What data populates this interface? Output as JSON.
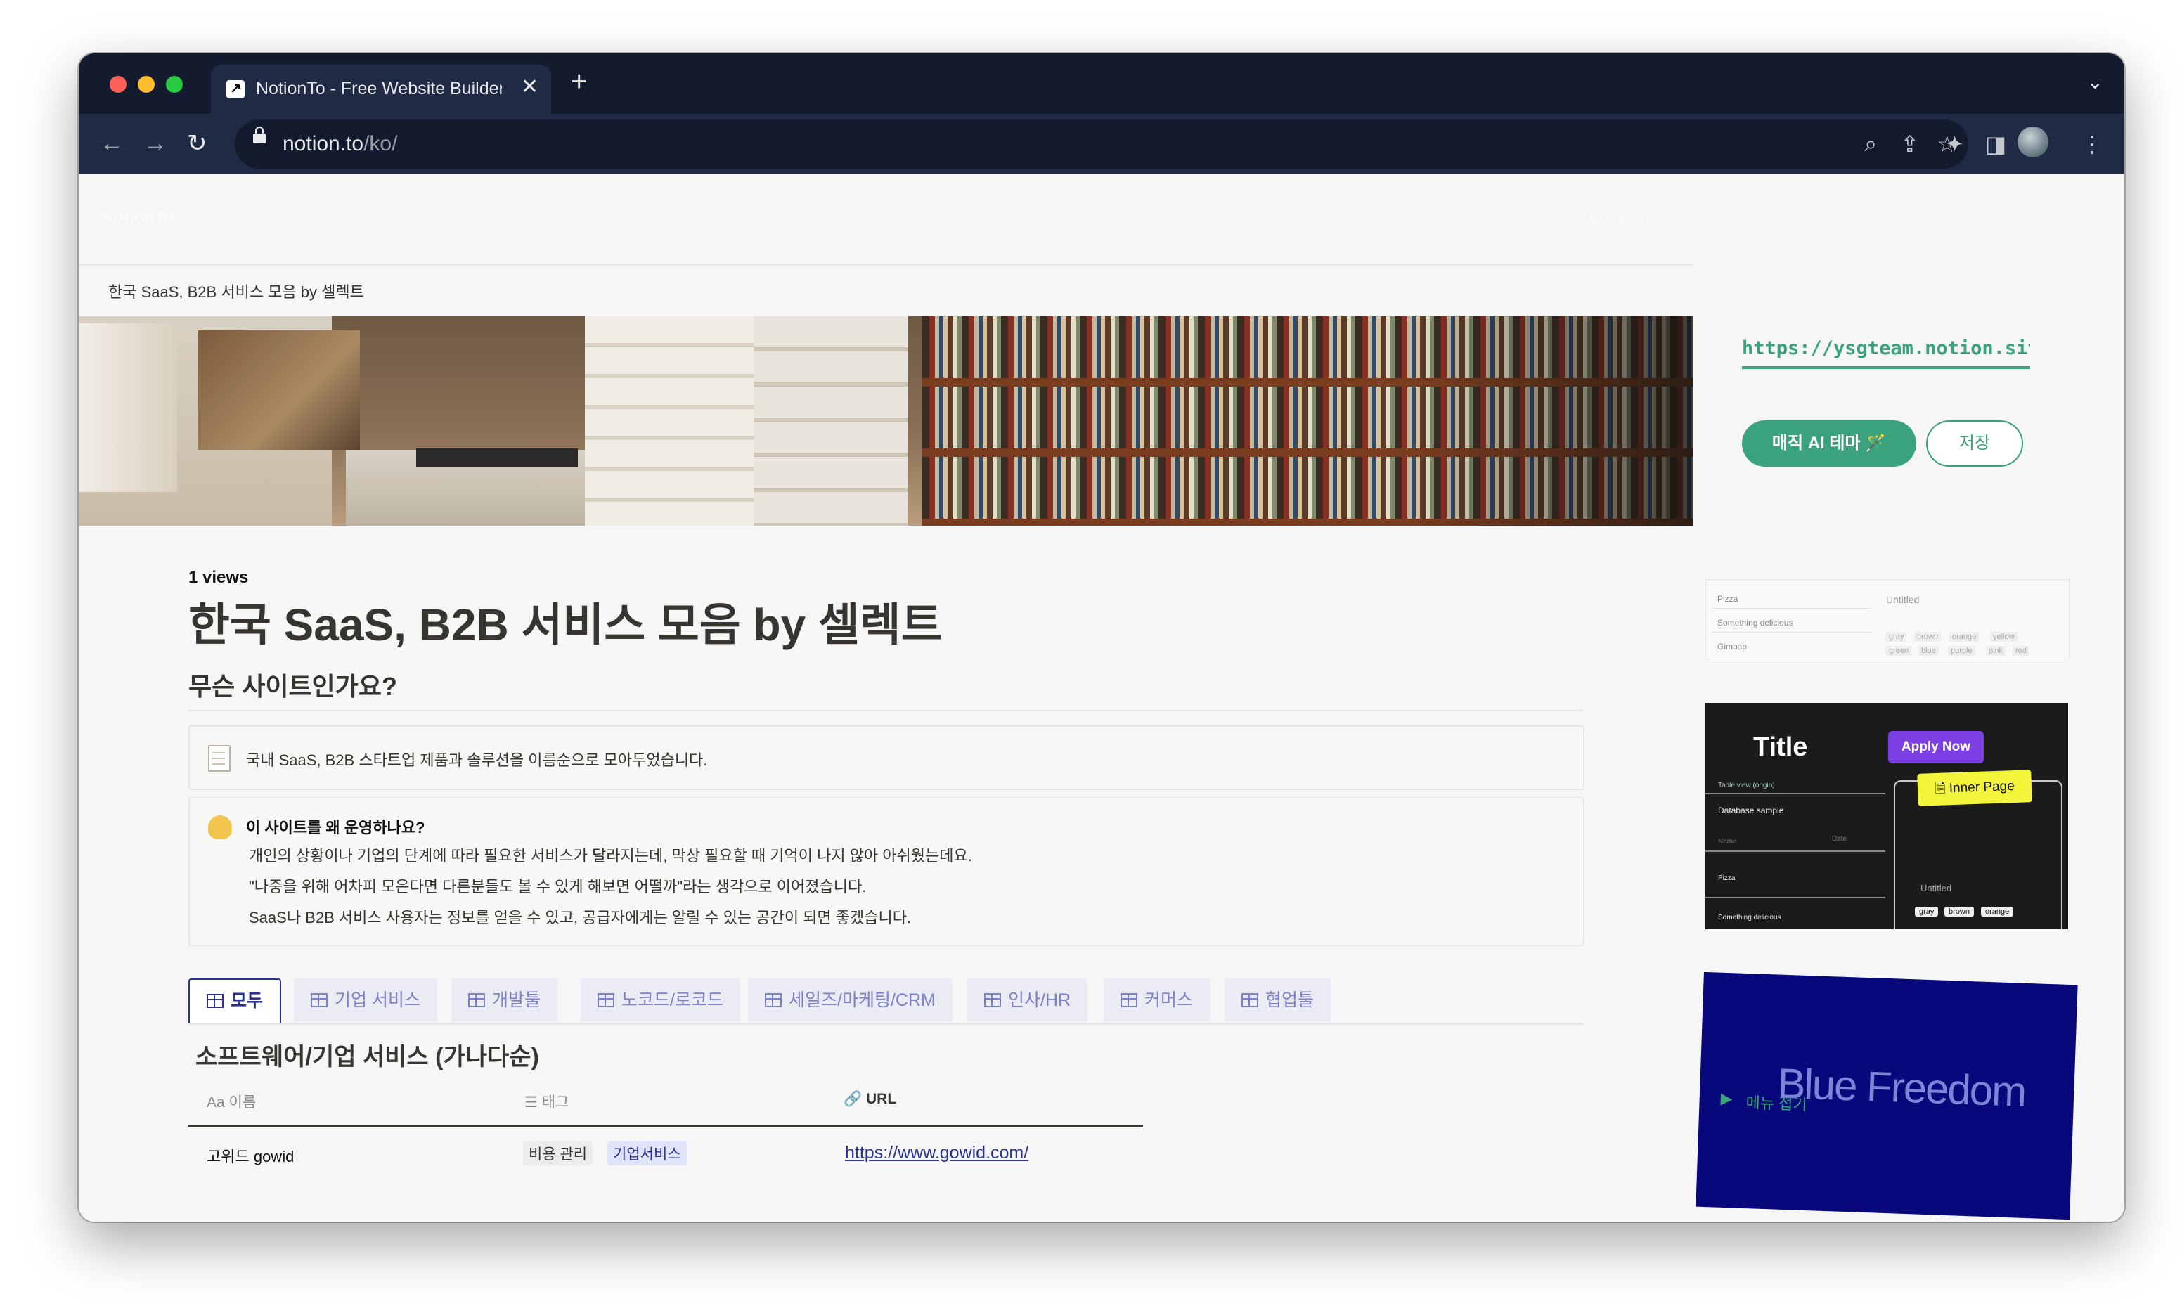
{
  "browser": {
    "tab_title": "NotionTo - Free Website Builder",
    "new_tab_symbol": "+",
    "close_symbol": "✕",
    "url_host": "notion.to",
    "url_path": "/ko/"
  },
  "site": {
    "logo": "NotionTo",
    "header_link": "노션보기",
    "breadcrumb": "한국 SaaS, B2B 서비스 모음 by 셀렉트"
  },
  "page": {
    "views": "1 views",
    "title": "한국 SaaS, B2B 서비스 모음 by 셀렉트",
    "section_heading": "무슨 사이트인가요?",
    "callout1_text": "국내 SaaS, B2B 스타트업 제품과 솔루션을 이름순으로 모아두었습니다.",
    "callout2": {
      "heading": "이 사이트를 왜 운영하나요?",
      "lines": [
        "개인의 상황이나 기업의 단계에 따라 필요한 서비스가 달라지는데, 막상 필요할 때 기억이 나지 않아 아쉬웠는데요.",
        "\"나중을 위해 어차피 모은다면 다른분들도 볼 수 있게 해보면 어떨까\"라는 생각으로 이어졌습니다.",
        "SaaS나 B2B 서비스 사용자는 정보를 얻을 수 있고, 공급자에게는 알릴 수 있는 공간이 되면 좋겠습니다."
      ]
    },
    "db_tabs": [
      "모두",
      "기업 서비스",
      "개발툴",
      "노코드/로코드",
      "세일즈/마케팅/CRM",
      "인사/HR",
      "커머스",
      "협업툴"
    ],
    "db_title": "소프트웨어/기업 서비스 (가나다순)",
    "columns": {
      "name": "이름",
      "name_prefix": "Aa",
      "tags": "태그",
      "url": "URL"
    },
    "rows": [
      {
        "name": "고위드 gowid",
        "tag1": "비용 관리",
        "tag2": "기업서비스",
        "url": "https://www.gowid.com/"
      }
    ]
  },
  "sidebar": {
    "notion_url": "https://ysgteam.notion.site...",
    "magic_button": "매직 AI 테마 🪄",
    "save_button": "저장",
    "card1": {
      "items": [
        "Pizza",
        "Something delicious",
        "Gimbap"
      ],
      "untitled": "Untitled",
      "chips": [
        "gray",
        "brown",
        "orange",
        "yellow",
        "green",
        "blue",
        "purple",
        "pink",
        "red"
      ]
    },
    "card2": {
      "title": "Title",
      "apply": "Apply Now",
      "inner": "Inner Page",
      "table_view": "Table view (origin)",
      "db_sample": "Database sample",
      "name": "Name",
      "date": "Date",
      "pizza": "Pizza",
      "something": "Something delicious",
      "untitled": "Untitled",
      "chips": [
        "gray",
        "brown",
        "orange"
      ]
    },
    "card3": {
      "text": "Blue Freedom",
      "menu": "메뉴 접기"
    }
  },
  "colors": {
    "accent_green": "#3aa37e",
    "db_blue": "#2a3294",
    "chrome_dark": "#141b2e"
  }
}
